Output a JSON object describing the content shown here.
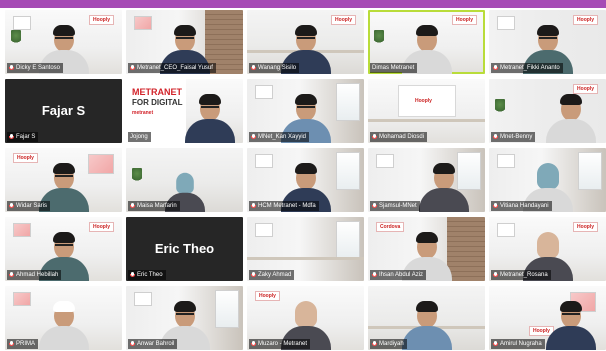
{
  "colors": {
    "top_bar": "#a64bb5",
    "active_speaker": "#b9dc3a",
    "tile_dark": "#262626"
  },
  "participants": [
    {
      "name": "Dicky E Santoso",
      "muted": true
    },
    {
      "name": "Metranet_CEO_Faisal Yusuf",
      "muted": true
    },
    {
      "name": "Wanang Sisilo",
      "muted": true
    },
    {
      "name": "Dimas Metranet",
      "muted": false,
      "active": true
    },
    {
      "name": "Metranet_Fikki Ananto",
      "muted": true
    },
    {
      "name": "Fajar S",
      "muted": true,
      "camera_off": true
    },
    {
      "name": "Jojong",
      "muted": false,
      "promo": {
        "line1": "METRANET",
        "line2": "FOR DIGITAL",
        "brand": "metranet"
      }
    },
    {
      "name": "MNet_Kan Xayyid",
      "muted": true
    },
    {
      "name": "Mohamad Diosdi",
      "muted": true
    },
    {
      "name": "Mnet-Benny",
      "muted": true
    },
    {
      "name": "Widar Saris",
      "muted": true
    },
    {
      "name": "Maisa Marfarin",
      "muted": true
    },
    {
      "name": "HCM Metranet - Mdfa",
      "muted": true
    },
    {
      "name": "Sjamsul-MNet",
      "muted": true
    },
    {
      "name": "Vitiana Handayani",
      "muted": true
    },
    {
      "name": "Ahmad Hebillah",
      "muted": true
    },
    {
      "name": "Eric Theo",
      "muted": true,
      "camera_off": true
    },
    {
      "name": "Zaky Ahmad",
      "muted": true
    },
    {
      "name": "Ihsan Abdul Aziz",
      "muted": true
    },
    {
      "name": "Metranet_Rosana",
      "muted": true
    },
    {
      "name": "PRIMA",
      "muted": true
    },
    {
      "name": "Anwar Bahroil",
      "muted": true
    },
    {
      "name": "Muzaro - Metranet",
      "muted": true
    },
    {
      "name": "Mardiyah",
      "muted": true
    },
    {
      "name": "Amirul Nugraha",
      "muted": true
    }
  ],
  "logos": {
    "mini": "Hooply",
    "board": "Cordova"
  }
}
